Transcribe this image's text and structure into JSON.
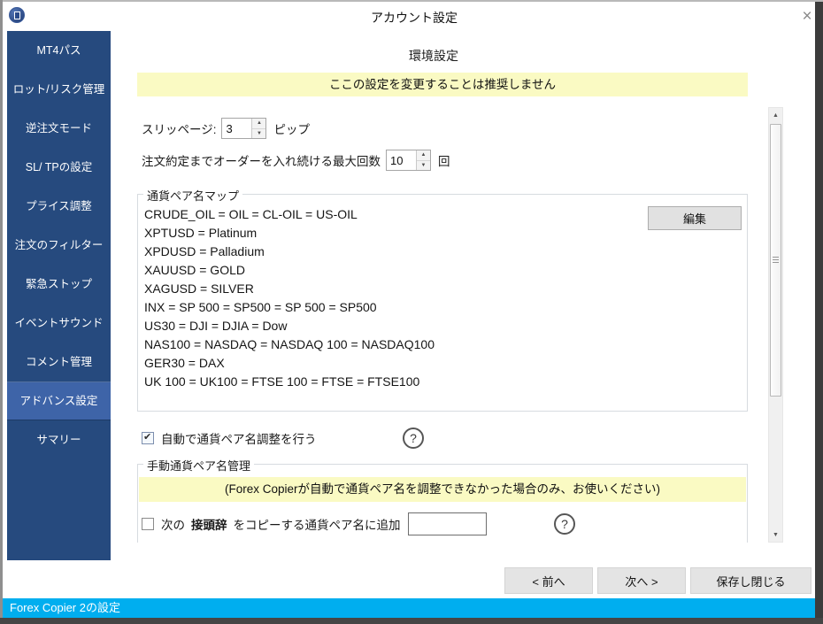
{
  "window": {
    "title": "アカウント設定",
    "close_label": "×"
  },
  "sidebar": {
    "items": [
      {
        "label": "MT4パス",
        "selected": false
      },
      {
        "label": "ロット/リスク管理",
        "selected": false
      },
      {
        "label": "逆注文モード",
        "selected": false
      },
      {
        "label": "SL/ TPの設定",
        "selected": false
      },
      {
        "label": "プライス調整",
        "selected": false
      },
      {
        "label": "注文のフィルター",
        "selected": false
      },
      {
        "label": "緊急ストップ",
        "selected": false
      },
      {
        "label": "イベントサウンド",
        "selected": false
      },
      {
        "label": "コメント管理",
        "selected": false
      },
      {
        "label": "アドバンス設定",
        "selected": true
      },
      {
        "label": "サマリー",
        "selected": false
      }
    ]
  },
  "main": {
    "heading": "環境設定",
    "warning": "ここの設定を変更することは推奨しません",
    "slippage": {
      "label": "スリッページ:",
      "value": "3",
      "unit": "ピップ"
    },
    "max_attempts": {
      "label": "注文約定までオーダーを入れ続ける最大回数",
      "value": "10",
      "unit": "回"
    },
    "pair_map": {
      "title": "通貨ペア名マップ",
      "edit_button": "編集",
      "entries": [
        "CRUDE_OIL = OIL = CL-OIL = US-OIL",
        "XPTUSD = Platinum",
        "XPDUSD = Palladium",
        "XAUUSD = GOLD",
        "XAGUSD = SILVER",
        "INX = SP 500 = SP500 = SP 500 = SP500",
        "US30 = DJI = DJIA = Dow",
        "NAS100 = NASDAQ = NASDAQ 100 = NASDAQ100",
        "GER30 = DAX",
        "UK 100 = UK100 = FTSE 100 = FTSE = FTSE100"
      ]
    },
    "auto_adjust": {
      "label": "自動で通貨ペア名調整を行う",
      "checked": true,
      "help": "?"
    },
    "manual_section": {
      "title": "手動通貨ペア名管理",
      "note": "(Forex Copierが自動で通貨ペア名を調整できなかった場合のみ、お使いください)",
      "prefix_row": {
        "label_before": "次の",
        "label_bold": "接頭辞",
        "label_after": "をコピーする通貨ペア名に追加",
        "value": "",
        "checked": false,
        "help": "?"
      }
    }
  },
  "footer": {
    "prev_button": "< 前へ",
    "next_button": "次へ >",
    "save_button": "保存し閉じる"
  },
  "statusbar": {
    "text": "Forex Copier 2の設定"
  },
  "colors": {
    "sidebar": "#264a7e",
    "sidebar_selected": "#3e64a8",
    "warning_bg": "#fafac3",
    "statusbar_bg": "#00aeef"
  }
}
